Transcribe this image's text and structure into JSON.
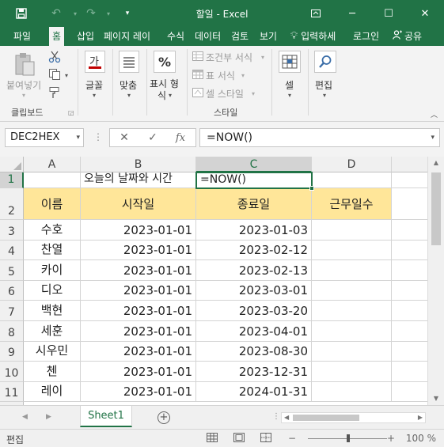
{
  "titlebar": {
    "title": "할일 - Excel",
    "save_icon": "save-icon",
    "undo_icon": "undo-icon",
    "redo_icon": "redo-icon",
    "customize_icon": "customize-quick-access-icon"
  },
  "ribbon_tabs": [
    {
      "label": "파일",
      "active": false
    },
    {
      "label": "홈",
      "active": true
    },
    {
      "label": "삽입",
      "active": false
    },
    {
      "label": "페이지 레이",
      "active": false
    },
    {
      "label": "수식",
      "active": false
    },
    {
      "label": "데이터",
      "active": false
    },
    {
      "label": "검토",
      "active": false
    },
    {
      "label": "보기",
      "active": false
    }
  ],
  "tellme": "입력하세",
  "signin": "로그인",
  "share": "공유",
  "ribbon": {
    "paste": "붙여넣기",
    "clipboard_group": "클립보드",
    "font": "글꼴",
    "alignment": "맞춤",
    "number_format_line1": "표시 형",
    "number_format_line2": "식",
    "conditional_format": "조건부 서식",
    "table_format": "표 서식",
    "cell_style": "셀 스타일",
    "styles_group": "스타일",
    "cells": "셀",
    "editing": "편집"
  },
  "formula_bar": {
    "name_box": "DEC2HEX",
    "cancel_label": "✕",
    "enter_label": "✓",
    "fx_label": "fx",
    "formula": "=NOW()"
  },
  "grid": {
    "columns": [
      "A",
      "B",
      "C",
      "D"
    ],
    "selected_column": "C",
    "rows": [
      "1",
      "2",
      "3",
      "4",
      "5",
      "6",
      "7",
      "8",
      "9",
      "10",
      "11"
    ],
    "row1_b": "오늘의 날짜와 시간",
    "row1_c": "=NOW()",
    "headers": [
      "이름",
      "시작일",
      "종료일",
      "근무일수"
    ],
    "header_fill": "#ffe699",
    "data": [
      {
        "name": "수호",
        "start": "2023-01-01",
        "end": "2023-01-03"
      },
      {
        "name": "찬열",
        "start": "2023-01-01",
        "end": "2023-02-12"
      },
      {
        "name": "카이",
        "start": "2023-01-01",
        "end": "2023-02-13"
      },
      {
        "name": "디오",
        "start": "2023-01-01",
        "end": "2023-03-01"
      },
      {
        "name": "백현",
        "start": "2023-01-01",
        "end": "2023-03-20"
      },
      {
        "name": "세훈",
        "start": "2023-01-01",
        "end": "2023-04-01"
      },
      {
        "name": "시우민",
        "start": "2023-01-01",
        "end": "2023-08-30"
      },
      {
        "name": "첸",
        "start": "2023-01-01",
        "end": "2023-12-31"
      },
      {
        "name": "레이",
        "start": "2023-01-01",
        "end": "2024-01-31"
      }
    ]
  },
  "sheets": [
    {
      "name": "Sheet1",
      "active": true
    }
  ],
  "statusbar": {
    "mode": "편집",
    "zoom_label": "100 %"
  },
  "colors": {
    "excel_green": "#217346",
    "header_yellow": "#ffe699"
  }
}
